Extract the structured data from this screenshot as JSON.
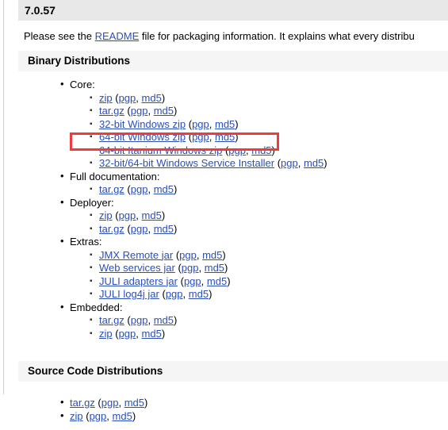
{
  "page": {
    "version_heading": "7.0.57",
    "intro_text_before_link": "Please see the ",
    "intro_link_label": "README",
    "intro_text_after_link": " file for packaging information. It explains what every distribu",
    "binary_heading": "Binary Distributions",
    "source_heading": "Source Code Distributions"
  },
  "labels": {
    "open_paren": "(",
    "close_paren": ")",
    "comma": ", ",
    "pgp": "pgp",
    "md5": "md5"
  },
  "binary_distributions": [
    {
      "category": "Core:",
      "files": [
        {
          "name": "zip"
        },
        {
          "name": "tar.gz"
        },
        {
          "name": "32-bit Windows zip"
        },
        {
          "name": "64-bit Windows zip"
        },
        {
          "name": "64-bit Itanium Windows zip"
        },
        {
          "name": "32-bit/64-bit Windows Service Installer"
        }
      ]
    },
    {
      "category": "Full documentation:",
      "files": [
        {
          "name": "tar.gz"
        }
      ]
    },
    {
      "category": "Deployer:",
      "files": [
        {
          "name": "zip"
        },
        {
          "name": "tar.gz"
        }
      ]
    },
    {
      "category": "Extras:",
      "files": [
        {
          "name": "JMX Remote jar"
        },
        {
          "name": "Web services jar"
        },
        {
          "name": "JULI adapters jar"
        },
        {
          "name": "JULI log4j jar"
        }
      ]
    },
    {
      "category": "Embedded:",
      "files": [
        {
          "name": "tar.gz"
        },
        {
          "name": "zip"
        }
      ]
    }
  ],
  "source_distributions": [
    {
      "name": "tar.gz"
    },
    {
      "name": "zip"
    }
  ],
  "annotation": {
    "highlight_target": "64-bit Windows zip",
    "highlight_color": "#ef3b3b"
  },
  "colors": {
    "link": "#2a4fb8",
    "version_band": "#e8e8e8",
    "section_band": "#f5f5f5",
    "left_rule": "#cfcfcf"
  }
}
